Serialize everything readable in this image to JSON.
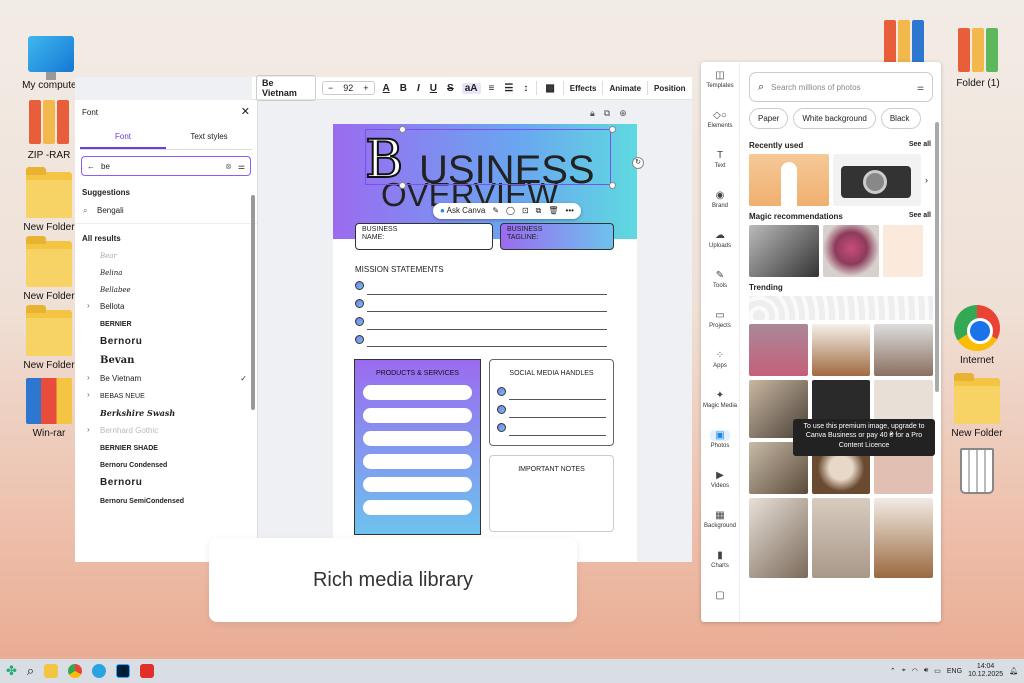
{
  "desktop": {
    "left_icons": [
      {
        "label": "My computer",
        "icon": "monitor-icon"
      },
      {
        "label": "ZIP -RAR",
        "icon": "binders-icon"
      },
      {
        "label": "New Folder",
        "icon": "folder-icon"
      },
      {
        "label": "New Folder",
        "icon": "folder-icon"
      },
      {
        "label": "New Folder",
        "icon": "folder-icon"
      },
      {
        "label": "Win-rar",
        "icon": "winrar-icon"
      }
    ],
    "right_icons": [
      {
        "label": "Folder (1)",
        "icon": "binders-icon"
      },
      {
        "label": "Internet",
        "icon": "chrome-icon"
      },
      {
        "label": "New Folder",
        "icon": "folder-icon"
      },
      {
        "label": "",
        "icon": "trash-icon"
      }
    ]
  },
  "toolbar": {
    "font": "Be Vietnam",
    "minus": "−",
    "size": "92",
    "plus": "+",
    "effects": "Effects",
    "animate": "Animate",
    "position": "Position"
  },
  "font_panel": {
    "title": "Font",
    "tab_font": "Font",
    "tab_styles": "Text styles",
    "query": "be",
    "suggestions_label": "Suggestions",
    "suggestion": "Bengali",
    "all_results_label": "All results",
    "fonts": [
      {
        "name": "Bear",
        "expand": false,
        "checked": false,
        "style": "script-faint"
      },
      {
        "name": "Belina",
        "expand": false,
        "checked": false,
        "style": "script"
      },
      {
        "name": "Bellabee",
        "expand": false,
        "checked": false,
        "style": "script"
      },
      {
        "name": "Bellota",
        "expand": true,
        "checked": false,
        "style": "normal"
      },
      {
        "name": "BERNIER",
        "expand": false,
        "checked": false,
        "style": "bold"
      },
      {
        "name": "Bernoru",
        "expand": false,
        "checked": false,
        "style": "heavy"
      },
      {
        "name": "Bevan",
        "expand": false,
        "checked": false,
        "style": "slab"
      },
      {
        "name": "Be Vietnam",
        "expand": true,
        "checked": true,
        "style": "normal"
      },
      {
        "name": "BEBAS NEUE",
        "expand": true,
        "checked": false,
        "style": "condensed"
      },
      {
        "name": "Berkshire Swash",
        "expand": false,
        "checked": false,
        "style": "swash"
      },
      {
        "name": "Bernhard Gothic",
        "expand": true,
        "checked": false,
        "style": "faint"
      },
      {
        "name": "BERNIER SHADE",
        "expand": false,
        "checked": false,
        "style": "bold"
      },
      {
        "name": "Bernoru Condensed",
        "expand": false,
        "checked": false,
        "style": "bold-small"
      },
      {
        "name": "Bernoru",
        "expand": false,
        "checked": false,
        "style": "heavy"
      },
      {
        "name": "Bernoru SemiCondensed",
        "expand": false,
        "checked": false,
        "style": "bold-small"
      }
    ]
  },
  "page": {
    "big_letter": "B",
    "title1": "USINESS",
    "title2": "OVERVIEW",
    "ask_canva": "Ask Canva",
    "name_label": "BUSINESS\nNAME:",
    "tagline_label": "BUSINESS\nTAGLINE:",
    "mission": "MISSION STATEMENTS",
    "products": "PRODUCTS & SERVICES",
    "social": "SOCIAL MEDIA HANDLES",
    "notes": "IMPORTANT NOTES"
  },
  "caption": "Rich media library",
  "right_panel": {
    "rail": [
      {
        "label": "Templates",
        "icon": "templates-icon",
        "glyph": "◫",
        "active": false
      },
      {
        "label": "Elements",
        "icon": "elements-icon",
        "glyph": "◇○",
        "active": false
      },
      {
        "label": "Text",
        "icon": "text-icon",
        "glyph": "T",
        "active": false
      },
      {
        "label": "Brand",
        "icon": "brand-icon",
        "glyph": "◉",
        "active": false
      },
      {
        "label": "Uploads",
        "icon": "uploads-icon",
        "glyph": "☁",
        "active": false
      },
      {
        "label": "Tools",
        "icon": "tools-icon",
        "glyph": "✎",
        "active": false
      },
      {
        "label": "Projects",
        "icon": "projects-icon",
        "glyph": "▭",
        "active": false
      },
      {
        "label": "Apps",
        "icon": "apps-icon",
        "glyph": "⁘",
        "active": false
      },
      {
        "label": "Magic Media",
        "icon": "magic-media-icon",
        "glyph": "✦",
        "active": false
      },
      {
        "label": "Photos",
        "icon": "photos-icon",
        "glyph": "▣",
        "active": true
      },
      {
        "label": "Videos",
        "icon": "videos-icon",
        "glyph": "▶",
        "active": false
      },
      {
        "label": "Background",
        "icon": "background-icon",
        "glyph": "▦",
        "active": false
      },
      {
        "label": "Charts",
        "icon": "charts-icon",
        "glyph": "▮",
        "active": false
      },
      {
        "label": "",
        "icon": "more-icon",
        "glyph": "▢",
        "active": false
      }
    ],
    "search_placeholder": "Search millions of photos",
    "chips": [
      "Paper",
      "White background",
      "Black"
    ],
    "recently_used": "Recently used",
    "see_all": "See all",
    "magic_recs": "Magic recommendations",
    "see_all_2": "See all",
    "trending": "Trending",
    "tooltip": "To use this premium image, upgrade to Canva Business or pay 40 ₴ for a Pro Content Licence"
  },
  "taskbar": {
    "lang": "ENG",
    "time": "14:04",
    "date": "10.12.2025"
  }
}
